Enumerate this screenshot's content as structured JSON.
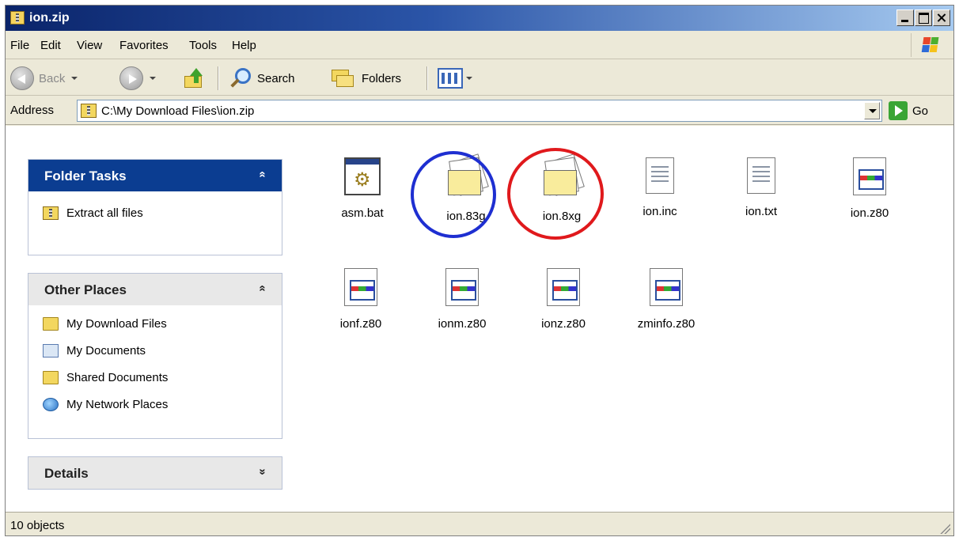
{
  "window": {
    "title": "ion.zip"
  },
  "menu": [
    "File",
    "Edit",
    "View",
    "Favorites",
    "Tools",
    "Help"
  ],
  "toolbar": {
    "back": "Back",
    "search": "Search",
    "folders": "Folders"
  },
  "address": {
    "label": "Address",
    "value": "C:\\My Download Files\\ion.zip",
    "go": "Go"
  },
  "folder_tasks": {
    "title": "Folder Tasks",
    "chevron": "«",
    "items": [
      "Extract all files"
    ]
  },
  "other_places": {
    "title": "Other Places",
    "chevron": "«",
    "items": [
      "My Download Files",
      "My Documents",
      "Shared Documents",
      "My Network Places"
    ]
  },
  "details": {
    "title": "Details",
    "chevron": "»"
  },
  "files": [
    {
      "name": "asm.bat",
      "type": "batch"
    },
    {
      "name": "ion.83g",
      "type": "folder",
      "highlight": "blue"
    },
    {
      "name": "ion.8xg",
      "type": "folder",
      "highlight": "red"
    },
    {
      "name": "ion.inc",
      "type": "text"
    },
    {
      "name": "ion.txt",
      "type": "text"
    },
    {
      "name": "ion.z80",
      "type": "z80"
    },
    {
      "name": "ionf.z80",
      "type": "z80"
    },
    {
      "name": "ionm.z80",
      "type": "z80"
    },
    {
      "name": "ionz.z80",
      "type": "z80"
    },
    {
      "name": "zminfo.z80",
      "type": "z80"
    }
  ],
  "highlight_colors": {
    "blue": "#1e2fd1",
    "red": "#e0191c"
  },
  "status": {
    "text": "10 objects"
  }
}
